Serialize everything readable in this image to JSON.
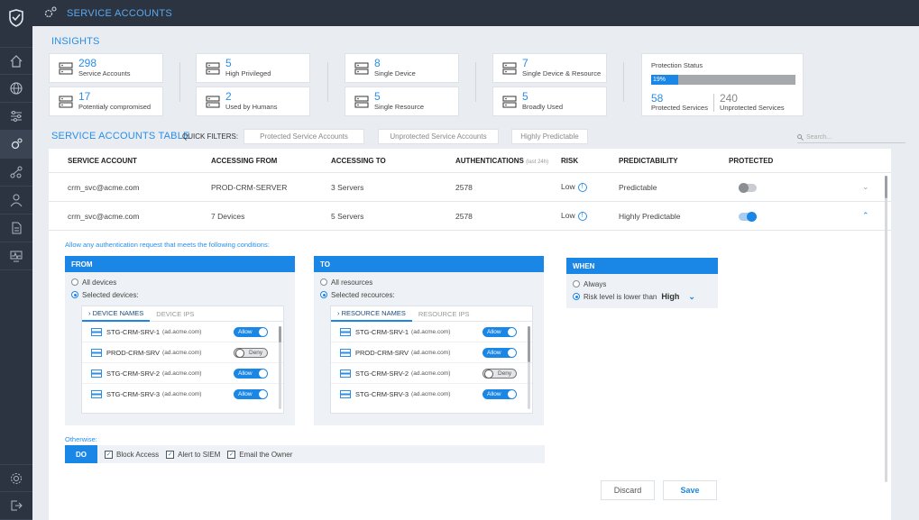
{
  "app": {
    "title": "SERVICE ACCOUNTS"
  },
  "sidebar": {
    "items": [
      {
        "icon": "home-icon"
      },
      {
        "icon": "globe-icon"
      },
      {
        "icon": "sliders-icon"
      },
      {
        "icon": "service-gear-icon"
      },
      {
        "icon": "graph-icon"
      },
      {
        "icon": "user-icon"
      },
      {
        "icon": "document-icon"
      },
      {
        "icon": "monitor-icon"
      }
    ],
    "bottom": [
      {
        "icon": "settings-icon"
      },
      {
        "icon": "logout-icon"
      }
    ]
  },
  "insights": {
    "title": "INSIGHTS",
    "cards": [
      {
        "value": "298",
        "label": "Service Accounts"
      },
      {
        "value": "17",
        "label": "Potentialy compromised"
      },
      {
        "value": "5",
        "label": "High Privileged"
      },
      {
        "value": "2",
        "label": "Used by Humans"
      },
      {
        "value": "8",
        "label": "Single Device"
      },
      {
        "value": "5",
        "label": "Single Resource"
      },
      {
        "value": "7",
        "label": "Single Device & Resource"
      },
      {
        "value": "5",
        "label": "Broadly Used"
      }
    ],
    "protection": {
      "title": "Protection Status",
      "percent_label": "19%",
      "percent": 19,
      "protected_value": "58",
      "protected_label": "Protected Services",
      "unprotected_value": "240",
      "unprotected_label": "Unprotected Services"
    }
  },
  "table_section": {
    "title": "SERVICE ACCOUNTS TABLE",
    "quick_filters_label": "QUICK FILTERS:",
    "filters": [
      "Protected Service Accounts",
      "Unprotected Service Accounts",
      "Highly Predictable"
    ],
    "search_placeholder": "Search..."
  },
  "table": {
    "headers": {
      "account": "SERVICE ACCOUNT",
      "from": "ACCESSING FROM",
      "to": "ACCESSING TO",
      "auth": "AUTHENTICATIONS",
      "auth_sub": "(last 24h)",
      "risk": "RISK",
      "predictability": "PREDICTABILITY",
      "protected": "PROTECTED"
    },
    "rows": [
      {
        "account": "crm_svc@acme.com",
        "from": "PROD-CRM-SERVER",
        "to": "3 Servers",
        "auth": "2578",
        "risk": "Low",
        "predictability": "Predictable",
        "protected": false
      },
      {
        "account": "crm_svc@acme.com",
        "from": "7 Devices",
        "to": "5 Servers",
        "auth": "2578",
        "risk": "Low",
        "predictability": "Highly Predictable",
        "protected": true
      }
    ]
  },
  "policy": {
    "conditions_title": "Allow any authentication request that meets the following conditions:",
    "from": {
      "title": "FROM",
      "opt_all": "All devices",
      "opt_selected": "Selected devices:",
      "tab_names": "DEVICE NAMES",
      "tab_ips": "DEVICE IPS",
      "devices": [
        {
          "name": "STG-CRM-SRV-1",
          "domain": "(ad.acme.com)",
          "state": "Allow"
        },
        {
          "name": "PROD-CRM-SRV",
          "domain": "(ad.acme.com)",
          "state": "Deny"
        },
        {
          "name": "STG-CRM-SRV-2",
          "domain": "(ad.acme.com)",
          "state": "Allow"
        },
        {
          "name": "STG-CRM-SRV-3",
          "domain": "(ad.acme.com)",
          "state": "Allow"
        }
      ]
    },
    "to": {
      "title": "TO",
      "opt_all": "All resources",
      "opt_selected": "Selected recources:",
      "tab_names": "RESOURCE NAMES",
      "tab_ips": "RESOURCE IPS",
      "resources": [
        {
          "name": "STG-CRM-SRV-1",
          "domain": "(ad.acme.com)",
          "state": "Allow"
        },
        {
          "name": "PROD-CRM-SRV",
          "domain": "(ad.acme.com)",
          "state": "Allow"
        },
        {
          "name": "STG-CRM-SRV-2",
          "domain": "(ad.acme.com)",
          "state": "Deny"
        },
        {
          "name": "STG-CRM-SRV-3",
          "domain": "(ad.acme.com)",
          "state": "Allow"
        }
      ]
    },
    "when": {
      "title": "WHEN",
      "opt_always": "Always",
      "opt_risk": "Risk level is lower than",
      "risk_value": "High"
    },
    "otherwise": {
      "title": "Otherwise:",
      "do_label": "DO",
      "actions": [
        "Block Access",
        "Alert to SIEM",
        "Email the Owner"
      ]
    },
    "discard_label": "Discard",
    "save_label": "Save"
  }
}
